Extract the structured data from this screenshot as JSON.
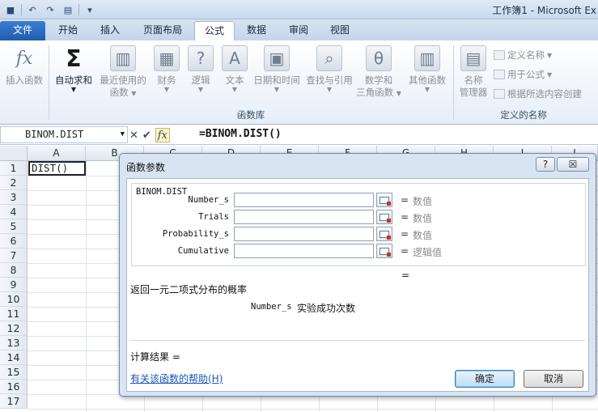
{
  "window": {
    "title": "工作簿1 - Microsoft Ex"
  },
  "tabs": [
    {
      "label": "文件"
    },
    {
      "label": "开始"
    },
    {
      "label": "插入"
    },
    {
      "label": "页面布局"
    },
    {
      "label": "公式"
    },
    {
      "label": "数据"
    },
    {
      "label": "审阅"
    },
    {
      "label": "视图"
    }
  ],
  "ribbon": {
    "insert_function": "插入函数",
    "autosum": "自动求和",
    "recent_line1": "最近使用的",
    "recent_line2": "函数",
    "financial": "财务",
    "logical": "逻辑",
    "text": "文本",
    "datetime": "日期和时间",
    "lookup": "查找与引用",
    "math_line1": "数学和",
    "math_line2": "三角函数",
    "more": "其他函数",
    "library_label": "函数库",
    "name_manager_line1": "名称",
    "name_manager_line2": "管理器",
    "define_name": "定义名称",
    "use_in_formula": "用于公式",
    "create_from_selection": "根据所选内容创建",
    "defined_names_label": "定义的名称"
  },
  "formula_bar": {
    "name_box": "BINOM.DIST",
    "formula": "=BINOM.DIST()"
  },
  "grid": {
    "columns": [
      "A",
      "B",
      "C",
      "D",
      "E",
      "F",
      "G",
      "H",
      "I",
      "J"
    ],
    "rows": [
      "1",
      "2",
      "3",
      "4",
      "5",
      "6",
      "7",
      "8",
      "9",
      "10",
      "11",
      "12",
      "13",
      "14",
      "15",
      "16",
      "17"
    ],
    "a1_value": "DIST()"
  },
  "dialog": {
    "title": "函数参数",
    "help_btn": "?",
    "close_btn": "☒",
    "function_name": "BINOM.DIST",
    "args": [
      {
        "label": "Number_s",
        "value": "",
        "result": "数值"
      },
      {
        "label": "Trials",
        "value": "",
        "result": "数值"
      },
      {
        "label": "Probability_s",
        "value": "",
        "result": "数值"
      },
      {
        "label": "Cumulative",
        "value": "",
        "result": "逻辑值"
      }
    ],
    "equals": "=",
    "description": "返回一元二项式分布的概率",
    "arg_desc_name": "Number_s",
    "arg_desc_text": "实验成功次数",
    "calc_result": "计算结果 =",
    "help_link": "有关该函数的帮助(H)",
    "ok": "确定",
    "cancel": "取消"
  }
}
